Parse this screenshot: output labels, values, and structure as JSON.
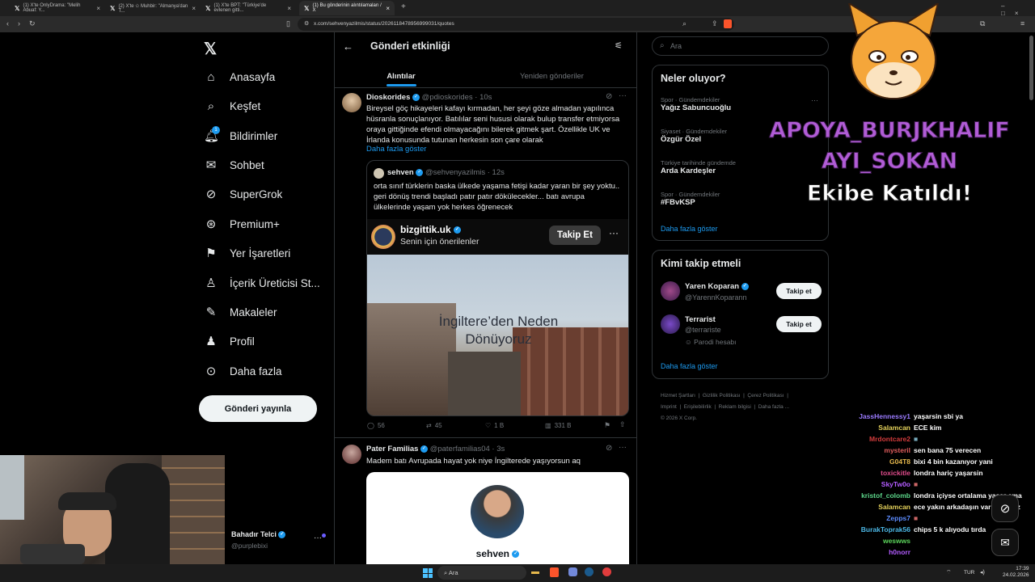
{
  "browser": {
    "tabs": [
      {
        "title": "(1) X'te OnlyDrama: \"Melih Abuaf: Y...",
        "active": false
      },
      {
        "title": "(2) X'te ✩ Muhbir: \"Almanya'dan T...",
        "active": false
      },
      {
        "title": "(1) X'te BPT: \"Türkiye'de evlenen gitti...",
        "active": false
      },
      {
        "title": "(1) Bu gönderinin alıntılamaları / X",
        "active": true
      }
    ],
    "url": "x.com/sehvenyazilmis/status/2026118478956999031/quotes"
  },
  "nav": {
    "items": [
      {
        "label": "Anasayfa",
        "icon": "home-icon"
      },
      {
        "label": "Keşfet",
        "icon": "search-icon"
      },
      {
        "label": "Bildirimler",
        "icon": "bell-icon",
        "badge": "1"
      },
      {
        "label": "Sohbet",
        "icon": "mail-icon"
      },
      {
        "label": "SuperGrok",
        "icon": "grok-icon"
      },
      {
        "label": "Premium+",
        "icon": "premium-icon"
      },
      {
        "label": "Yer İşaretleri",
        "icon": "bookmark-icon"
      },
      {
        "label": "İçerik Üreticisi St...",
        "icon": "creator-icon"
      },
      {
        "label": "Makaleler",
        "icon": "article-icon"
      },
      {
        "label": "Profil",
        "icon": "profile-icon"
      },
      {
        "label": "Daha fazla",
        "icon": "more-icon"
      }
    ],
    "post_button": "Gönderi yayınla",
    "account": {
      "name": "Bahadır Telci",
      "handle": "@purplebixi"
    }
  },
  "header": {
    "title": "Gönderi etkinliği",
    "tabs": [
      "Alıntılar",
      "Yeniden gönderiler"
    ]
  },
  "tweet1": {
    "name": "Dioskorides",
    "handle": "@pdioskorides",
    "time": "10s",
    "text": "Bireysel göç hikayeleri kafayı kırmadan, her şeyi göze almadan yapılınca hüsranla sonuçlanıyor. Batılılar seni hususi olarak bulup transfer etmiyorsa oraya gittiğinde efendi olmayacağını bilerek gitmek şart. Özellikle UK ve İrlanda konusunda tutunan herkesin son çare olarak",
    "show_more": "Daha fazla göster",
    "quote": {
      "name": "sehven",
      "handle": "@sehvenyazilmis",
      "time": "12s",
      "text": "orta sınıf türklerin baska ülkede yaşama fetişi kadar yaran bir şey yoktu.. geri dönüş trendi başladı patır patır dökülecekler... batı avrupa ülkelerinde yaşam yok herkes öğrenecek",
      "video": {
        "account": "bizgittik.uk",
        "subtitle": "Senin için önerilenler",
        "follow": "Takip Et",
        "caption_line1": "İngiltere’den Neden",
        "caption_line2": "Dönüyoruz"
      }
    },
    "stats": {
      "replies": "56",
      "reposts": "45",
      "likes": "1 B",
      "views": "331 B"
    }
  },
  "tweet2": {
    "name": "Pater Familias",
    "handle": "@paterfamilias04",
    "time": "3s",
    "text": "Madem batı Avrupada hayat yok niye İngilterede yaşıyorsun aq",
    "card_name": "sehven"
  },
  "right": {
    "search_placeholder": "Ara",
    "trends_title": "Neler oluyor?",
    "trends": [
      {
        "category": "Spor · Gündemdekiler",
        "name": "Yağız Sabuncuoğlu"
      },
      {
        "category": "Siyaset · Gündemdekiler",
        "name": "Özgür Özel"
      },
      {
        "category": "Türkiye tarihinde gündemde",
        "name": "Arda Kardeşler"
      },
      {
        "category": "Spor · Gündemdekiler",
        "name": "#FBvKSP"
      }
    ],
    "trends_more": "Daha fazla göster",
    "follow_title": "Kimi takip etmeli",
    "follow": [
      {
        "name": "Yaren Koparan",
        "handle": "@YarennKoparann",
        "button": "Takip et",
        "note": ""
      },
      {
        "name": "Terrarist",
        "handle": "@terrariste",
        "button": "Takip et",
        "note": "Parodi hesabı"
      }
    ],
    "follow_more": "Daha fazla göster",
    "footer": [
      "Hizmet Şartları",
      "Gizlilik Politikası",
      "Çerez Politikası",
      "Imprint",
      "Erişilebilirlik",
      "Reklam bilgisi",
      "Daha fazla ...",
      "© 2026 X Corp."
    ]
  },
  "overlay": {
    "line1": "APOYA_BURJKHALIF",
    "line2": "AYI_SOKAN",
    "line3": "Ekibe Katıldı!",
    "colors": {
      "purple": "#b15cd6",
      "white": "#ffffff"
    }
  },
  "chat": [
    {
      "user": "JassHennessy1",
      "msg": "yaşarsin sbi ya",
      "color": "#9b7bff"
    },
    {
      "user": "Salamcan",
      "msg": "ECE kim",
      "color": "#e6d35c"
    },
    {
      "user": "Mrdontcare2",
      "msg": "■",
      "color": "#d43c3c"
    },
    {
      "user": "mysteril",
      "msg": "sen bana 75 verecen",
      "color": "#e05d5d"
    },
    {
      "user": "G04T8",
      "msg": "bixi 4 bin kazanıyor yani",
      "color": "#e6b84c"
    },
    {
      "user": "toxickitle",
      "msg": "londra hariç yaşarsin",
      "color": "#e04c8c"
    },
    {
      "user": "SkyTw0o",
      "msg": "■",
      "color": "#b35cff"
    },
    {
      "user": "kristof_colomb",
      "msg": "londra içiyse ortalama yaşar ama",
      "color": "#5cd68a"
    },
    {
      "user": "Salamcan",
      "msg": "ece yakın arkadaşın varmı ingiliz",
      "color": "#e6d35c"
    },
    {
      "user": "Zepps7",
      "msg": "■",
      "color": "#5c8cff"
    },
    {
      "user": "BurakToprak56",
      "msg": "chips 5 k alıyodu tırda",
      "color": "#4cb8e6"
    },
    {
      "user": "weswws",
      "msg": "",
      "color": "#5cd65c"
    },
    {
      "user": "h0norr",
      "msg": "",
      "color": "#b35cff"
    }
  ],
  "taskbar": {
    "search": "Ara",
    "lang": "TUR",
    "time": "17:39",
    "date": "24.02.2026"
  }
}
